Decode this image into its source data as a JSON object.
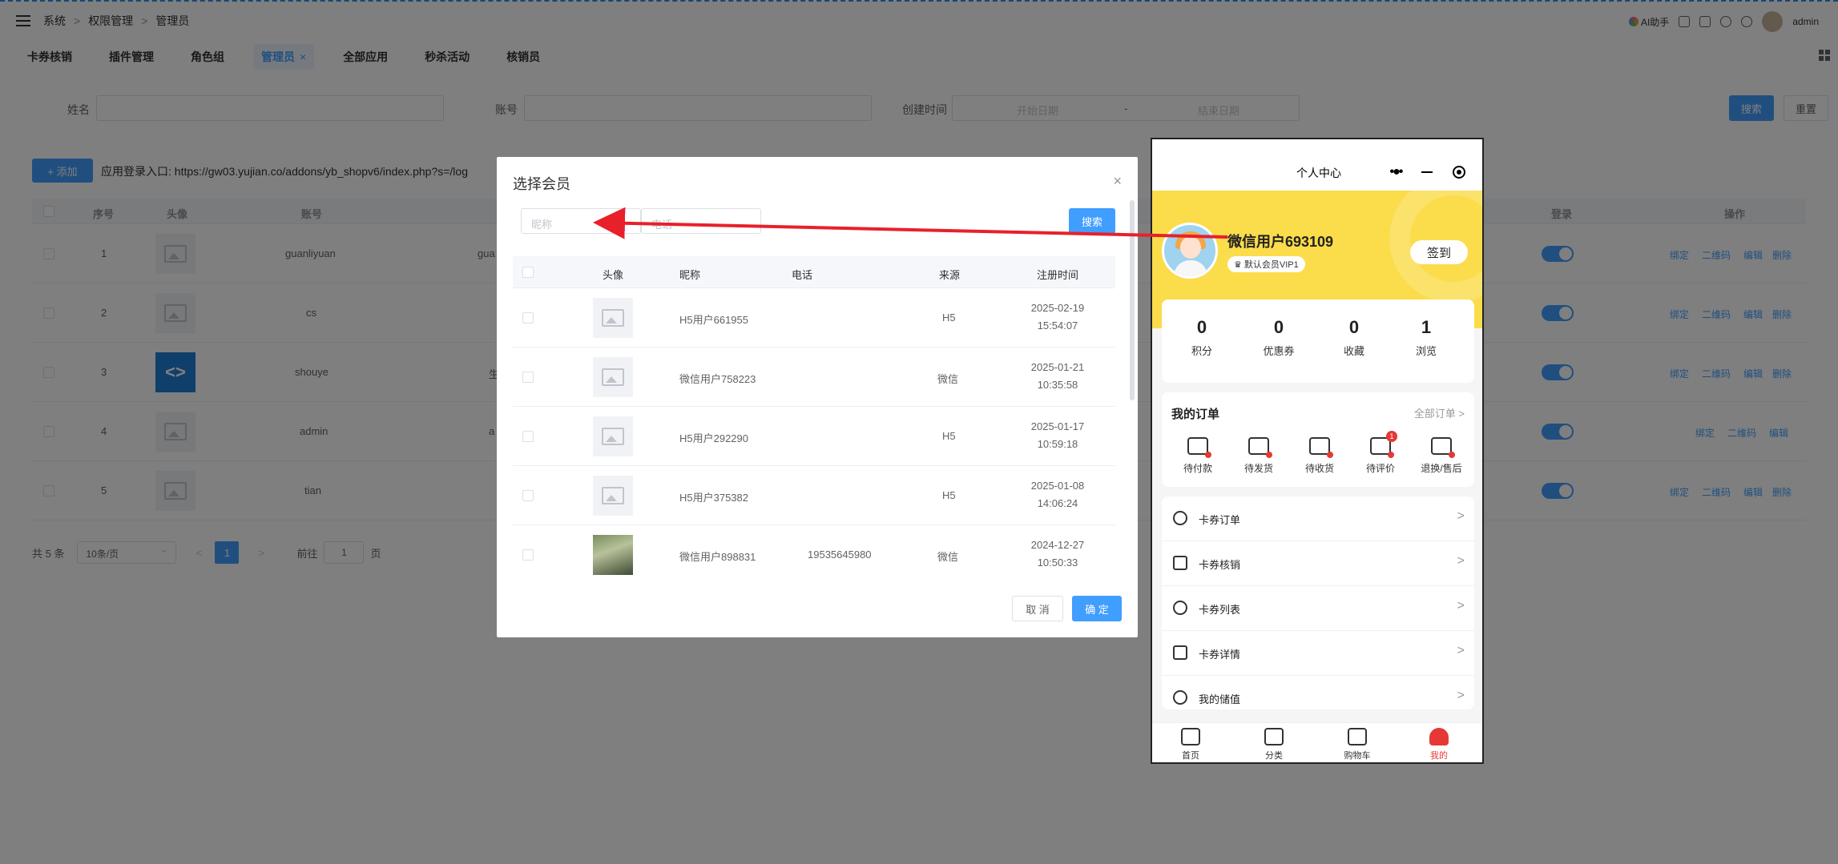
{
  "breadcrumb": [
    "系统",
    "权限管理",
    "管理员"
  ],
  "topbar": {
    "ai_label": "AI助手",
    "user": "admin"
  },
  "tabs": [
    {
      "label": "卡券核销",
      "active": false
    },
    {
      "label": "插件管理",
      "active": false
    },
    {
      "label": "角色组",
      "active": false
    },
    {
      "label": "管理员",
      "active": true,
      "close": "×"
    },
    {
      "label": "全部应用",
      "active": false
    },
    {
      "label": "秒杀活动",
      "active": false
    },
    {
      "label": "核销员",
      "active": false
    }
  ],
  "filters": {
    "name_label": "姓名",
    "account_label": "账号",
    "created_label": "创建时间",
    "start_placeholder": "开始日期",
    "date_sep": "-",
    "end_placeholder": "结束日期",
    "search_button": "搜索",
    "reset_button": "重置"
  },
  "actions": {
    "add_button": "+ 添加",
    "entry_text": "应用登录入口: https://gw03.yujian.co/addons/yb_shopv6/index.php?s=/log"
  },
  "table": {
    "headers": [
      "序号",
      "头像",
      "账号",
      "登录",
      "操作"
    ],
    "rows": [
      {
        "no": "1",
        "account": "guanliyuan",
        "extra": "gua",
        "ops": [
          "绑定",
          "二维码",
          "编辑",
          "删除"
        ]
      },
      {
        "no": "2",
        "account": "cs",
        "extra": "",
        "ops": [
          "绑定",
          "二维码",
          "编辑",
          "删除"
        ]
      },
      {
        "no": "3",
        "account": "shouye",
        "extra": "生",
        "ops": [
          "绑定",
          "二维码",
          "编辑",
          "删除"
        ]
      },
      {
        "no": "4",
        "account": "admin",
        "extra": "a",
        "ops": [
          "绑定",
          "二维码",
          "编辑"
        ]
      },
      {
        "no": "5",
        "account": "tian",
        "extra": "",
        "ops": [
          "绑定",
          "二维码",
          "编辑",
          "删除"
        ]
      }
    ]
  },
  "pagination": {
    "total": "共 5 条",
    "page_size": "10条/页",
    "prev": "<",
    "current": "1",
    "next": ">",
    "goto_label": "前往",
    "goto_value": "1",
    "page_suffix": "页"
  },
  "modal": {
    "title": "选择会员",
    "close": "×",
    "nickname_placeholder": "昵称",
    "phone_placeholder": "电话",
    "search_button": "搜索",
    "headers": [
      "头像",
      "昵称",
      "电话",
      "来源",
      "注册时间"
    ],
    "rows": [
      {
        "nickname": "H5用户661955",
        "phone": "",
        "source": "H5",
        "date": "2025-02-19",
        "time": "15:54:07",
        "photo": false
      },
      {
        "nickname": "微信用户758223",
        "phone": "",
        "source": "微信",
        "date": "2025-01-21",
        "time": "10:35:58",
        "photo": false
      },
      {
        "nickname": "H5用户292290",
        "phone": "",
        "source": "H5",
        "date": "2025-01-17",
        "time": "10:59:18",
        "photo": false
      },
      {
        "nickname": "H5用户375382",
        "phone": "",
        "source": "H5",
        "date": "2025-01-08",
        "time": "14:06:24",
        "photo": false
      },
      {
        "nickname": "微信用户898831",
        "phone": "19535645980",
        "source": "微信",
        "date": "2024-12-27",
        "time": "10:50:33",
        "photo": true
      }
    ],
    "cancel_button": "取 消",
    "ok_button": "确 定"
  },
  "phone": {
    "title": "个人中心",
    "capsule_dots": "•●•",
    "user_name": "微信用户693109",
    "vip_label": "默认会员VIP1",
    "vip_icon": "♛",
    "sign_button": "签到",
    "stats": [
      {
        "value": "0",
        "label": "积分"
      },
      {
        "value": "0",
        "label": "优惠券"
      },
      {
        "value": "0",
        "label": "收藏"
      },
      {
        "value": "1",
        "label": "浏览"
      }
    ],
    "orders_title": "我的订单",
    "orders_all": "全部订单 >",
    "order_items": [
      {
        "label": "待付款",
        "badge": ""
      },
      {
        "label": "待发货",
        "badge": ""
      },
      {
        "label": "待收货",
        "badge": ""
      },
      {
        "label": "待评价",
        "badge": "1"
      },
      {
        "label": "退换/售后",
        "badge": ""
      }
    ],
    "menu": [
      {
        "label": "卡券订单",
        "icon": "star-icon"
      },
      {
        "label": "卡券核销",
        "icon": "ticket-icon"
      },
      {
        "label": "卡券列表",
        "icon": "clock-icon"
      },
      {
        "label": "卡券详情",
        "icon": "database-icon"
      },
      {
        "label": "我的储值",
        "icon": "yen-icon"
      }
    ],
    "menu_arrow": ">",
    "tabbar": [
      {
        "label": "首页",
        "active": false
      },
      {
        "label": "分类",
        "active": false
      },
      {
        "label": "购物车",
        "active": false
      },
      {
        "label": "我的",
        "active": true
      }
    ]
  },
  "colors": {
    "primary": "#409eff",
    "hero": "#fbdc4b",
    "arrow": "#e8202a",
    "active_tab": "#e53935"
  }
}
